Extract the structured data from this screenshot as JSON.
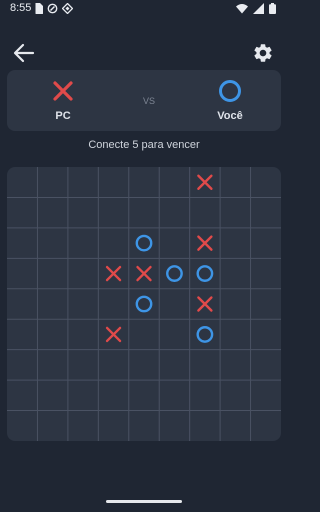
{
  "status_bar": {
    "time": "8:55"
  },
  "players": {
    "pc": {
      "name": "PC",
      "symbol": "X",
      "color": "#e04a4a"
    },
    "you": {
      "name": "Você",
      "symbol": "O",
      "color": "#3e95e6"
    },
    "vs_label": "VS"
  },
  "hint": "Conecte 5 para vencer",
  "board": {
    "rows": 9,
    "cols": 9,
    "cells": [
      {
        "row": 0,
        "col": 6,
        "mark": "X"
      },
      {
        "row": 2,
        "col": 4,
        "mark": "O"
      },
      {
        "row": 2,
        "col": 6,
        "mark": "X"
      },
      {
        "row": 3,
        "col": 3,
        "mark": "X"
      },
      {
        "row": 3,
        "col": 4,
        "mark": "X"
      },
      {
        "row": 3,
        "col": 5,
        "mark": "O"
      },
      {
        "row": 3,
        "col": 6,
        "mark": "O"
      },
      {
        "row": 4,
        "col": 4,
        "mark": "O"
      },
      {
        "row": 4,
        "col": 6,
        "mark": "X"
      },
      {
        "row": 5,
        "col": 3,
        "mark": "X"
      },
      {
        "row": 5,
        "col": 6,
        "mark": "O"
      }
    ]
  }
}
